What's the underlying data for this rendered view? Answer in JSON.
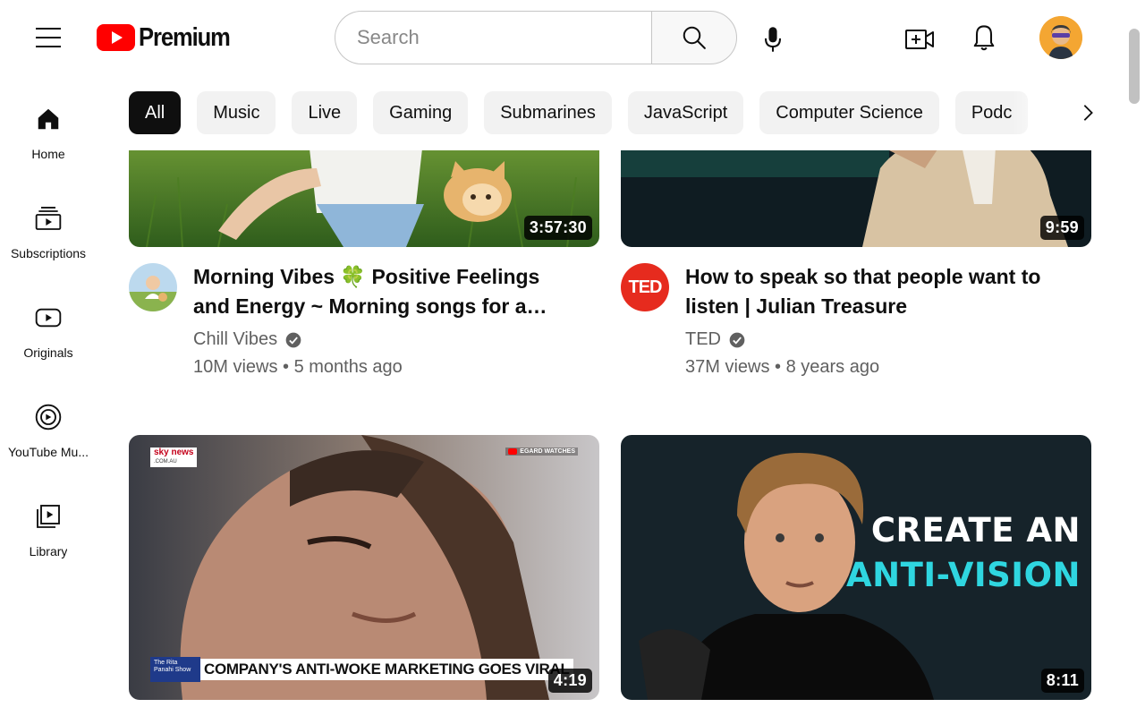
{
  "brand": {
    "logo_text": "Premium"
  },
  "search": {
    "placeholder": "Search"
  },
  "sidebar": {
    "items": [
      {
        "label": "Home",
        "icon": "home-icon"
      },
      {
        "label": "Subscriptions",
        "icon": "subscriptions-icon"
      },
      {
        "label": "Originals",
        "icon": "originals-icon"
      },
      {
        "label": "YouTube Mu...",
        "icon": "youtube-music-icon"
      },
      {
        "label": "Library",
        "icon": "library-icon"
      }
    ]
  },
  "chips": [
    "All",
    "Music",
    "Live",
    "Gaming",
    "Submarines",
    "JavaScript",
    "Computer Science",
    "Podc"
  ],
  "videos": [
    {
      "title": "Morning Vibes 🍀 Positive Feelings and Energy ~ Morning songs for a…",
      "channel": "Chill Vibes",
      "verified": true,
      "meta": "10M views • 5 months ago",
      "duration": "3:57:30"
    },
    {
      "title": "How to speak so that people want to listen | Julian Treasure",
      "channel": "TED",
      "avatar_text": "TED",
      "verified": true,
      "meta": "37M views • 8 years ago",
      "duration": "9:59"
    },
    {
      "duration": "4:19",
      "overlay": {
        "network": "sky news",
        "network_sub": ".COM.AU",
        "corner": "EGARD WATCHES",
        "show": "The Rita Panahi Show",
        "headline": "COMPANY'S ANTI-WOKE MARKETING GOES VIRAL"
      }
    },
    {
      "duration": "8:11",
      "overlay": {
        "line1": "CREATE AN",
        "line2": "ANTI-VISION"
      }
    }
  ],
  "colors": {
    "brand_red": "#ff0000",
    "accent_cyan": "#2fd6e0",
    "text_secondary": "#606060"
  }
}
